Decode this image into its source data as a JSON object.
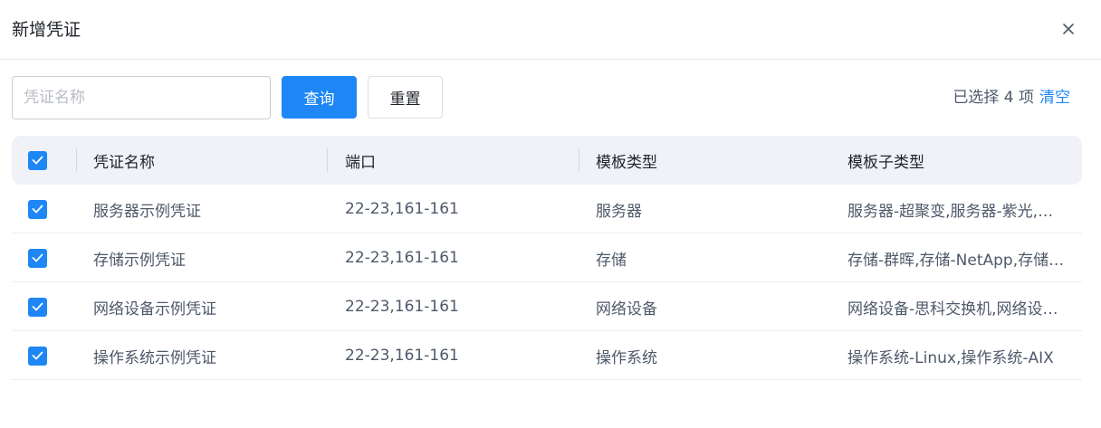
{
  "dialog": {
    "title": "新增凭证",
    "close_icon": "close-icon"
  },
  "toolbar": {
    "search_placeholder": "凭证名称",
    "search_value": "",
    "query_label": "查询",
    "reset_label": "重置",
    "selected_text": "已选择 4 项",
    "clear_label": "清空"
  },
  "table": {
    "columns": [
      "凭证名称",
      "端口",
      "模板类型",
      "模板子类型"
    ],
    "all_selected": true,
    "rows": [
      {
        "selected": true,
        "name": "服务器示例凭证",
        "port": "22-23,161-161",
        "template_type": "服务器",
        "template_subtype": "服务器-超聚变,服务器-紫光,服务器-华为"
      },
      {
        "selected": true,
        "name": "存储示例凭证",
        "port": "22-23,161-161",
        "template_type": "存储",
        "template_subtype": "存储-群晖,存储-NetApp,存储-华为"
      },
      {
        "selected": true,
        "name": "网络设备示例凭证",
        "port": "22-23,161-161",
        "template_type": "网络设备",
        "template_subtype": "网络设备-思科交换机,网络设备-华为交换机"
      },
      {
        "selected": true,
        "name": "操作系统示例凭证",
        "port": "22-23,161-161",
        "template_type": "操作系统",
        "template_subtype": "操作系统-Linux,操作系统-AIX"
      }
    ]
  },
  "colors": {
    "primary": "#1e87f5",
    "header_bg": "#f0f2f7",
    "text": "#1f2329",
    "muted_text": "#4e5969"
  }
}
